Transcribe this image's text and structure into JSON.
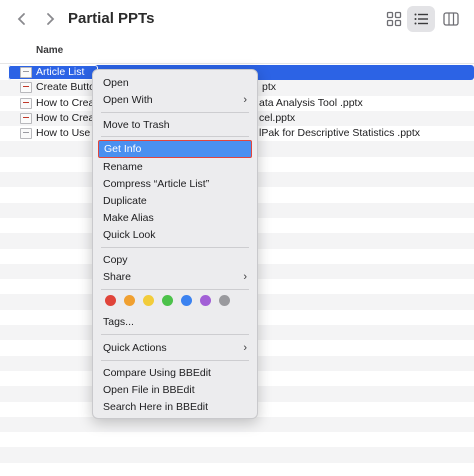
{
  "window": {
    "title": "Partial PPTs"
  },
  "header": {
    "name_col": "Name"
  },
  "files": [
    {
      "name": "Article List",
      "tail": ""
    },
    {
      "name": "Create Butto",
      "tail": "ptx"
    },
    {
      "name": "How to Crea",
      "tail": "ata Analysis Tool .pptx"
    },
    {
      "name": "How to Crea",
      "tail": "cel.pptx"
    },
    {
      "name": "How to Use",
      "tail": "lPak for Descriptive Statistics .pptx"
    }
  ],
  "menu": {
    "open": "Open",
    "open_with": "Open With",
    "move_to_trash": "Move to Trash",
    "get_info": "Get Info",
    "rename": "Rename",
    "compress": "Compress “Article List”",
    "duplicate": "Duplicate",
    "make_alias": "Make Alias",
    "quick_look": "Quick Look",
    "copy": "Copy",
    "share": "Share",
    "tags": "Tags...",
    "quick_actions": "Quick Actions",
    "compare_bbedit": "Compare Using BBEdit",
    "open_bbedit": "Open File in BBEdit",
    "search_bbedit": "Search Here in BBEdit",
    "submenu_chevron": "›"
  },
  "tag_colors": [
    "#e0443a",
    "#f0a030",
    "#f2cc3a",
    "#4cc24a",
    "#3b82f0",
    "#a25fd6",
    "#9a9a9e"
  ],
  "colors": {
    "selection": "#2c63e5",
    "highlight": "#4a90f0",
    "highlight_border": "#e2453c"
  }
}
